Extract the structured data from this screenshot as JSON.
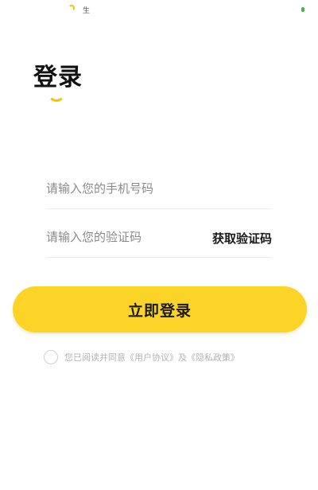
{
  "status_bar": {
    "text": "生"
  },
  "login": {
    "title": "登录",
    "phone_placeholder": "请输入您的手机号码",
    "code_placeholder": "请输入您的验证码",
    "get_code_label": "获取验证码",
    "submit_label": "立即登录"
  },
  "agreement": {
    "prefix": "您已阅读并同意",
    "user_agreement": "《用户协议》",
    "conjunction": "及",
    "privacy_policy": "《隐私政策》"
  },
  "colors": {
    "accent": "#fcd428",
    "title": "#111111",
    "placeholder": "#8a8a8a",
    "agreement_text": "#b3b3b3"
  }
}
